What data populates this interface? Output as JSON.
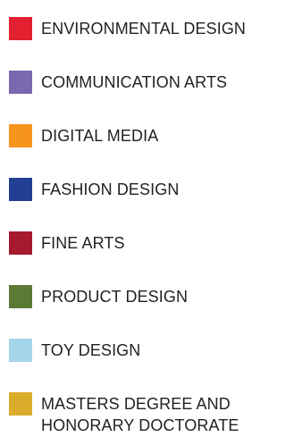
{
  "legend": {
    "items": [
      {
        "label": "ENVIRONMENTAL DESIGN",
        "color": "#e3202f"
      },
      {
        "label": "COMMUNICATION ARTS",
        "color": "#7b69b0"
      },
      {
        "label": "DIGITAL MEDIA",
        "color": "#f7941e"
      },
      {
        "label": "FASHION DESIGN",
        "color": "#213f93"
      },
      {
        "label": "FINE ARTS",
        "color": "#a6192e"
      },
      {
        "label": "PRODUCT DESIGN",
        "color": "#5b7a34"
      },
      {
        "label": "TOY DESIGN",
        "color": "#a5d5eb"
      },
      {
        "label": "MASTERS DEGREE AND",
        "label_line2": "HONORARY DOCTORATE",
        "color": "#d9ac2b"
      }
    ]
  }
}
